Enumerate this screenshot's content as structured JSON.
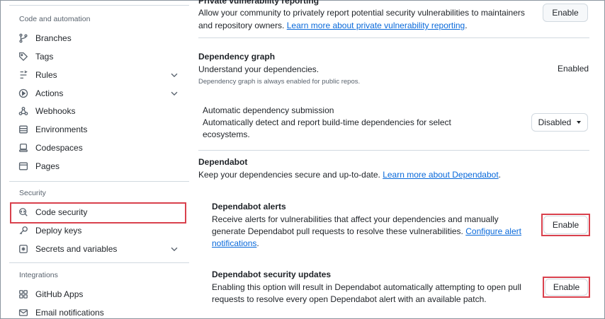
{
  "sidebar": {
    "sections": [
      {
        "heading": "Code and automation"
      },
      {
        "heading": "Security"
      },
      {
        "heading": "Integrations"
      }
    ],
    "items": [
      {
        "label": "Branches",
        "icon": "branch-icon"
      },
      {
        "label": "Tags",
        "icon": "tag-icon"
      },
      {
        "label": "Rules",
        "icon": "rules-icon"
      },
      {
        "label": "Actions",
        "icon": "play-icon"
      },
      {
        "label": "Webhooks",
        "icon": "webhook-icon"
      },
      {
        "label": "Environments",
        "icon": "server-icon"
      },
      {
        "label": "Codespaces",
        "icon": "codespaces-icon"
      },
      {
        "label": "Pages",
        "icon": "browser-icon"
      },
      {
        "label": "Code security",
        "icon": "codescan-icon"
      },
      {
        "label": "Deploy keys",
        "icon": "key-icon"
      },
      {
        "label": "Secrets and variables",
        "icon": "asterisk-icon"
      },
      {
        "label": "GitHub Apps",
        "icon": "apps-icon"
      },
      {
        "label": "Email notifications",
        "icon": "mail-icon"
      }
    ]
  },
  "main": {
    "private_reporting": {
      "title": "Private vulnerability reporting",
      "desc": "Allow your community to privately report potential security vulnerabilities to maintainers",
      "desc2": "and repository owners.",
      "link": "Learn more about private vulnerability reporting",
      "after_link": ".",
      "button": "Enable"
    },
    "dependency_graph": {
      "title": "Dependency graph",
      "desc": "Understand your dependencies.",
      "note": "Dependency graph is always enabled for public repos.",
      "status": "Enabled"
    },
    "auto_submission": {
      "title": "Automatic dependency submission",
      "desc": "Automatically detect and report build-time dependencies for select",
      "desc2": "ecosystems.",
      "button": "Disabled"
    },
    "dependabot": {
      "title": "Dependabot",
      "desc": "Keep your dependencies secure and up-to-date.",
      "link": "Learn more about Dependabot",
      "after_link": "."
    },
    "dependabot_alerts": {
      "title": "Dependabot alerts",
      "desc": "Receive alerts for vulnerabilities that affect your dependencies and manually",
      "desc2": "generate Dependabot pull requests to resolve these vulnerabilities.",
      "link1": "Configure alert",
      "link2": "notifications",
      "after_link": ".",
      "button": "Enable"
    },
    "security_updates": {
      "title": "Dependabot security updates",
      "desc": "Enabling this option will result in Dependabot automatically attempting to open pull",
      "desc2": "requests to resolve every open Dependabot alert with an available patch.",
      "button": "Enable"
    }
  }
}
